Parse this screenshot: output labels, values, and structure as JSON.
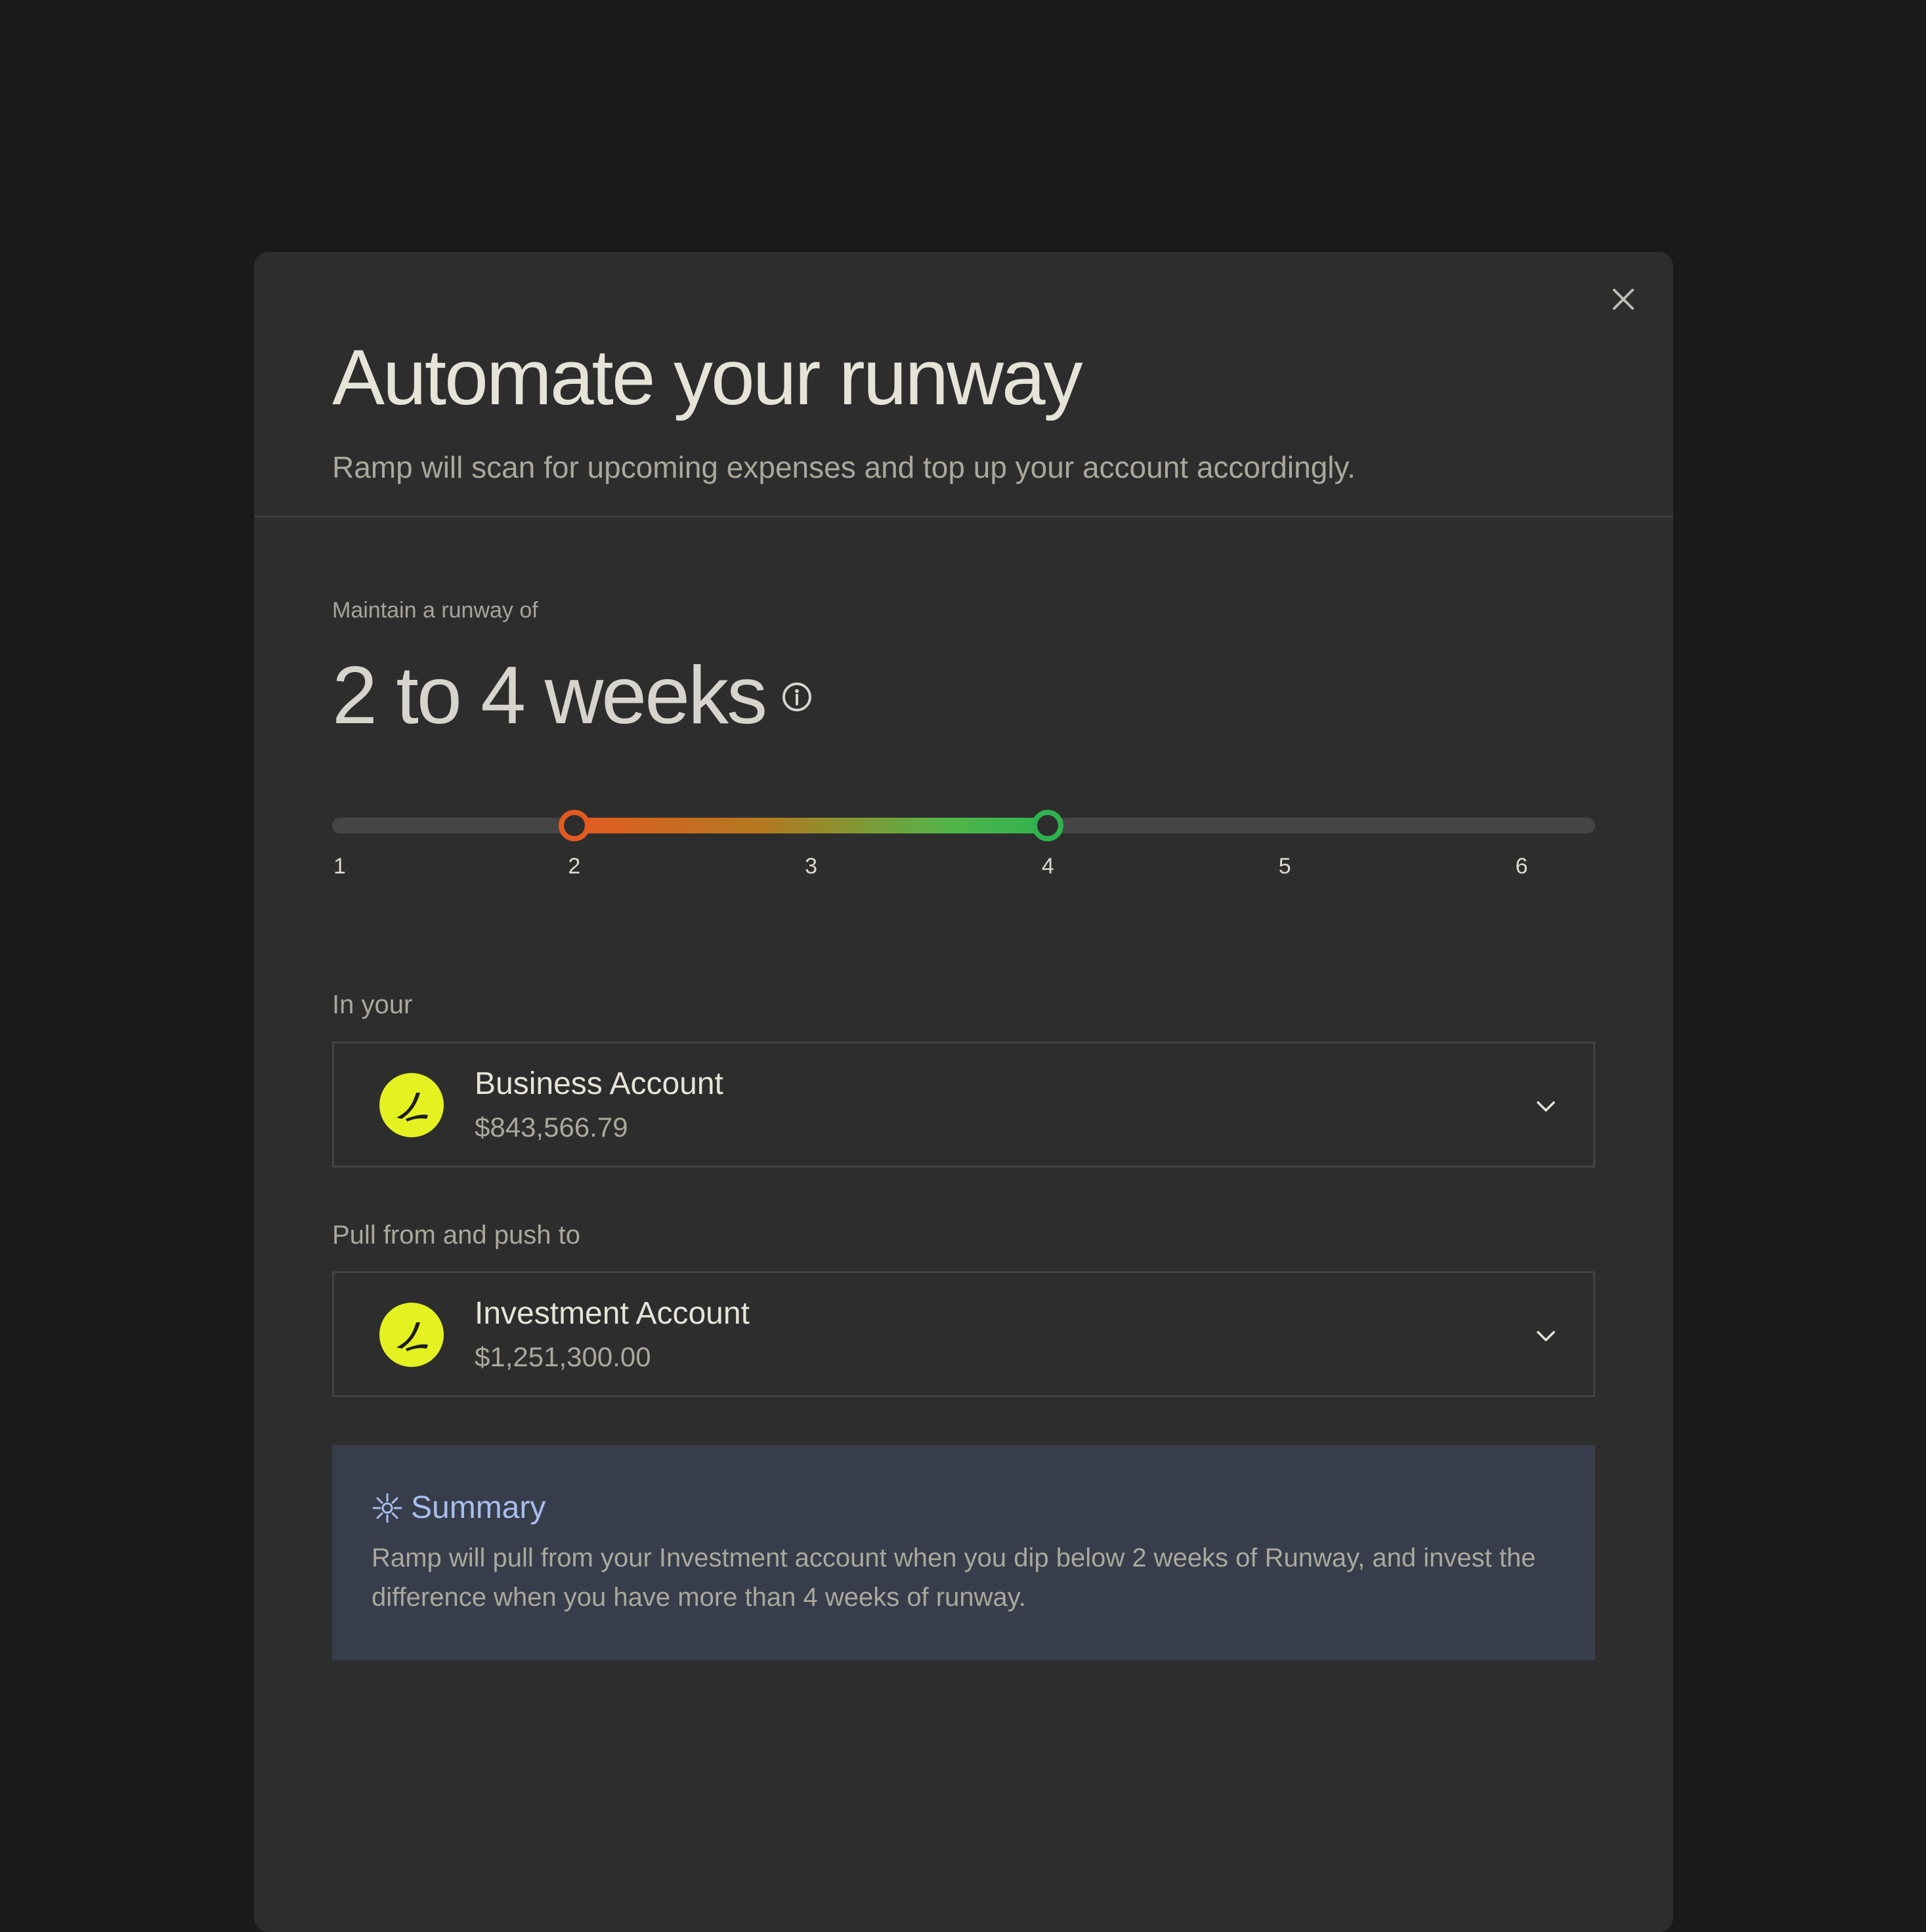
{
  "colors": {
    "page_background": "#1a1a1a",
    "modal_background": "#2d2d2d",
    "slider_min_color": "#e35a21",
    "slider_max_color": "#2fb24f",
    "account_logo_color": "#e4f221",
    "summary_background": "#373d4b",
    "summary_accent": "#a9bfec"
  },
  "modal": {
    "close_icon": "close-icon",
    "title": "Automate your runway",
    "subtitle": "Ramp will scan for upcoming expenses and top up your account accordingly."
  },
  "runway": {
    "label": "Maintain a runway of",
    "value_text": "2 to 4 weeks",
    "info_icon": "info-icon",
    "slider": {
      "min": 1,
      "max": 6,
      "selected_min": 2,
      "selected_max": 4,
      "ticks": [
        "1",
        "2",
        "3",
        "4",
        "5",
        "6"
      ]
    }
  },
  "accounts": {
    "in_your": {
      "label": "In your",
      "name": "Business Account",
      "balance": "$843,566.79",
      "icon": "ramp-logo-icon"
    },
    "pull_push": {
      "label": "Pull from and push to",
      "name": "Investment Account",
      "balance": "$1,251,300.00",
      "icon": "ramp-logo-icon"
    }
  },
  "summary": {
    "icon": "sparkle-icon",
    "title": "Summary",
    "text": "Ramp will pull from your Investment account when you dip below 2 weeks of Runway, and invest the difference when you have more than 4 weeks of runway."
  }
}
